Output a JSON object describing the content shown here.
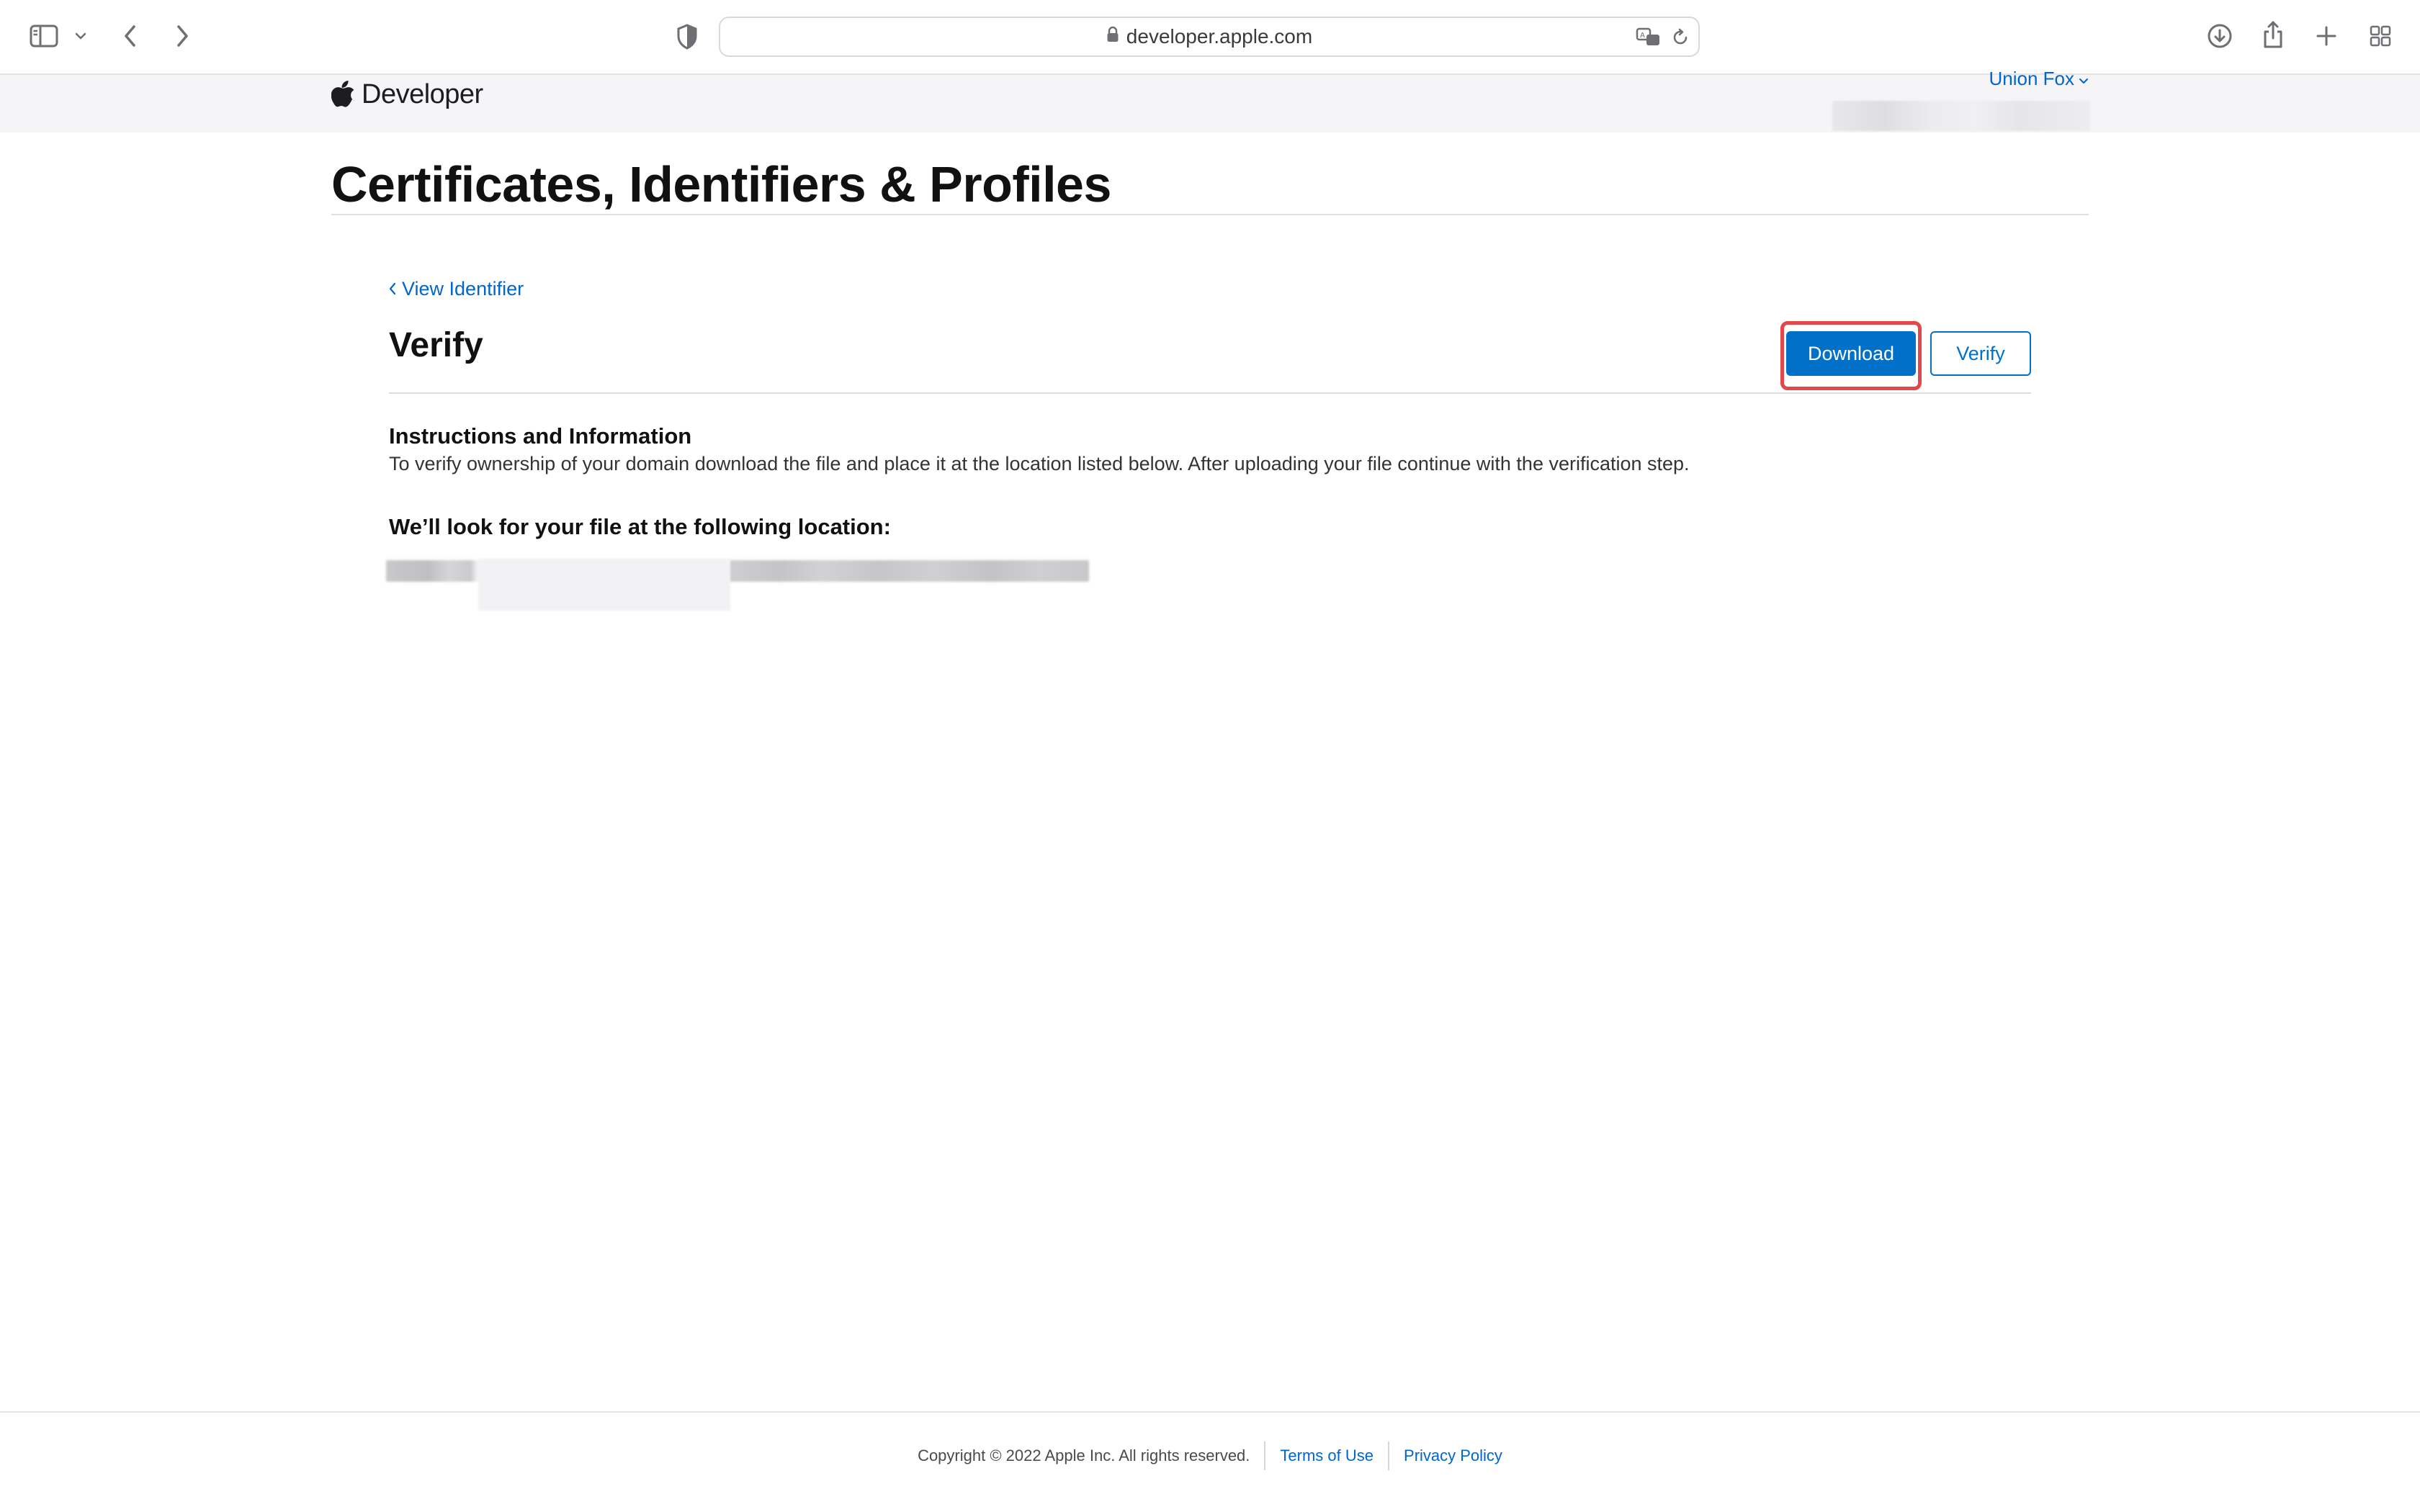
{
  "browser": {
    "url": "developer.apple.com",
    "icons": {
      "sidebar": "sidebar-icon",
      "sidebar_menu": "chevron-down-icon",
      "back": "chevron-left-icon",
      "forward": "chevron-right-icon",
      "privacy": "shield-icon",
      "lock": "lock-icon",
      "translate": "translate-icon",
      "reload": "reload-icon",
      "downloads": "download-icon",
      "share": "share-icon",
      "new_tab": "plus-icon",
      "tab_overview": "grid-icon"
    }
  },
  "devnav": {
    "brand": "Developer",
    "user_name": "Union Fox"
  },
  "page": {
    "title": "Certificates, Identifiers & Profiles",
    "back_link": "View Identifier",
    "section_title": "Verify",
    "download_label": "Download",
    "verify_label": "Verify",
    "info_heading": "Instructions and Information",
    "info_text": "To verify ownership of your domain download the file and place it at the location listed below. After uploading your file continue with the verification step.",
    "location_heading": "We’ll look for your file at the following location:"
  },
  "footer": {
    "copyright": "Copyright © 2022 Apple Inc. All rights reserved.",
    "terms": "Terms of Use",
    "privacy": "Privacy Policy"
  },
  "colors": {
    "accent": "#0070c9",
    "link": "#0066cc",
    "highlight": "#e0484a",
    "nav_background": "#f5f5f7"
  }
}
